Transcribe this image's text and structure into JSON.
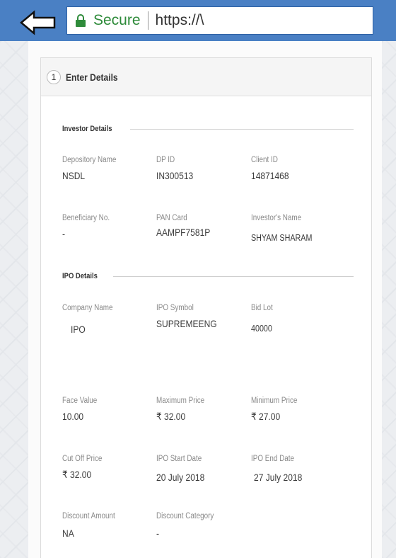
{
  "browser": {
    "back_icon": "left-arrow-icon",
    "lock_icon": "lock-icon",
    "secure_label": "Secure",
    "url": "https://\\"
  },
  "card": {
    "step_number": "1",
    "title": "Enter Details"
  },
  "investor": {
    "section_title": "Investor Details",
    "depository_name_label": "Depository Name",
    "depository_name": "NSDL",
    "dp_id_label": "DP ID",
    "dp_id": "IN300513",
    "client_id_label": "Client ID",
    "client_id": "14871468",
    "beneficiary_label": "Beneficiary No.",
    "beneficiary": "-",
    "pan_label": "PAN Card",
    "pan": "AAMPF7581P",
    "investor_name_label": "Investor's Name",
    "investor_name": "SHYAM SHARAM"
  },
  "ipo": {
    "section_title": "IPO Details",
    "company_name_label": "Company Name",
    "company_name": "IPO",
    "symbol_label": "IPO Symbol",
    "symbol": "SUPREMEENG",
    "bid_lot_label": "Bid Lot",
    "bid_lot": "40000",
    "face_value_label": "Face Value",
    "face_value": "10.00",
    "max_price_label": "Maximum Price",
    "max_price": "₹ 32.00",
    "min_price_label": "Minimum Price",
    "min_price": "₹ 27.00",
    "cut_off_label": "Cut Off Price",
    "cut_off": "₹ 32.00",
    "start_date_label": "IPO Start Date",
    "start_date": "20 July 2018",
    "end_date_label": "IPO End Date",
    "end_date": "27 July 2018",
    "discount_amount_label": "Discount Amount",
    "discount_amount": "NA",
    "discount_category_label": "Discount Category",
    "discount_category": "-"
  },
  "colors": {
    "topbar": "#4a80c4",
    "secure": "#2e8b3a"
  }
}
